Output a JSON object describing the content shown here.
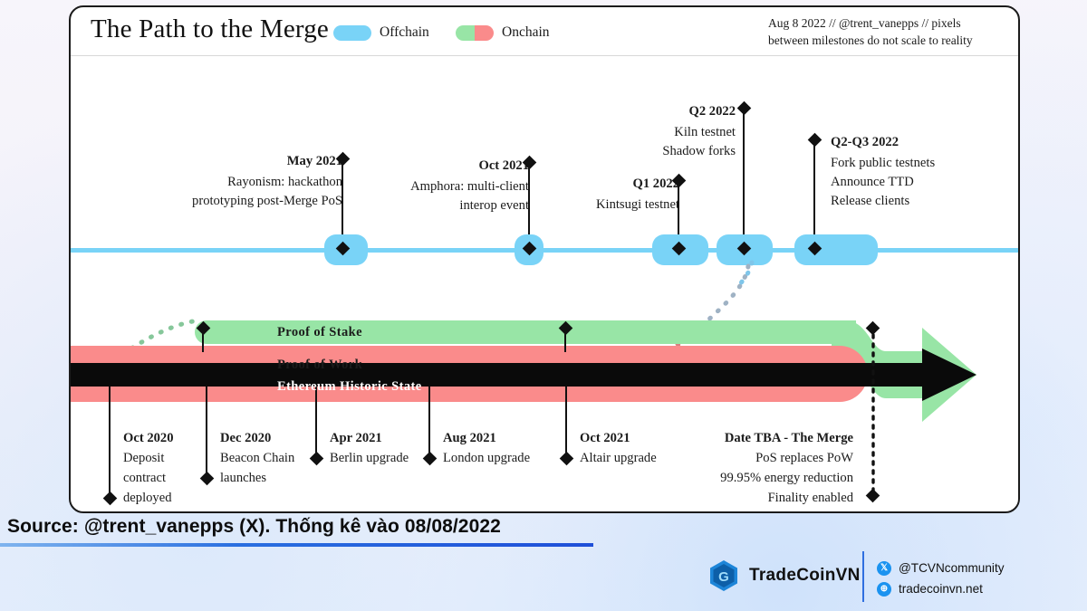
{
  "header": {
    "title": "The Path to the Merge",
    "legend": [
      {
        "key": "offchain",
        "label": "Offchain",
        "color": "#79d3f7"
      },
      {
        "key": "onchain",
        "label": "Onchain",
        "colors": [
          "#98e5a6",
          "#fa8b8b"
        ]
      }
    ],
    "note_line1": "Aug 8 2022 // @trent_vanepps // pixels",
    "note_line2": "between milestones do not scale to reality"
  },
  "offchain_milestones": [
    {
      "date": "May 2021",
      "lines": [
        "Rayonism: hackathon",
        "prototyping post-Merge PoS"
      ],
      "align": "right"
    },
    {
      "date": "Oct 2021",
      "lines": [
        "Amphora: multi-client",
        "interop event"
      ],
      "align": "right"
    },
    {
      "date": "Q1 2022",
      "lines": [
        "Kintsugi testnet"
      ],
      "align": "right"
    },
    {
      "date": "Q2 2022",
      "lines": [
        "Kiln testnet",
        "Shadow forks"
      ],
      "align": "right"
    },
    {
      "date": "Q2-Q3 2022",
      "lines": [
        "Fork public testnets",
        "Announce TTD",
        "Release clients"
      ],
      "align": "left"
    }
  ],
  "bands": [
    {
      "key": "pos",
      "label": "Proof of Stake",
      "color": "#98e5a6",
      "text_color": "#1b1b1b"
    },
    {
      "key": "pow",
      "label": "Proof of Work",
      "color": "#fa8b8b",
      "text_color": "#1b1b1b"
    },
    {
      "key": "historic",
      "label": "Ethereum Historic State",
      "color": "#0a0a0a",
      "text_color": "#ffffff"
    }
  ],
  "onchain_milestones": [
    {
      "date": "Oct 2020",
      "lines": [
        "Deposit",
        "contract",
        "deployed"
      ],
      "align": "left"
    },
    {
      "date": "Dec 2020",
      "lines": [
        "Beacon Chain",
        "launches"
      ],
      "align": "left"
    },
    {
      "date": "Apr 2021",
      "lines": [
        "Berlin upgrade"
      ],
      "align": "left"
    },
    {
      "date": "Aug 2021",
      "lines": [
        "London upgrade"
      ],
      "align": "left"
    },
    {
      "date": "Oct 2021",
      "lines": [
        "Altair upgrade"
      ],
      "align": "left"
    },
    {
      "date": "Date TBA - The Merge",
      "lines": [
        "PoS replaces PoW",
        "99.95% energy reduction",
        "Finality enabled"
      ],
      "align": "right"
    }
  ],
  "caption": "Source: @trent_vanepps (X). Thống kê vào 08/08/2022",
  "footer": {
    "brand": "TradeCoinVN",
    "socials": [
      {
        "icon": "x-icon",
        "glyph": "𝕏",
        "text": "@TCVNcommunity"
      },
      {
        "icon": "globe-icon",
        "glyph": "⊕",
        "text": "tradecoinvn.net"
      }
    ]
  },
  "colors": {
    "offchain": "#79d3f7",
    "pos": "#98e5a6",
    "pow": "#fa8b8b",
    "historic": "#0a0a0a",
    "accent": "#2a6fe0"
  }
}
